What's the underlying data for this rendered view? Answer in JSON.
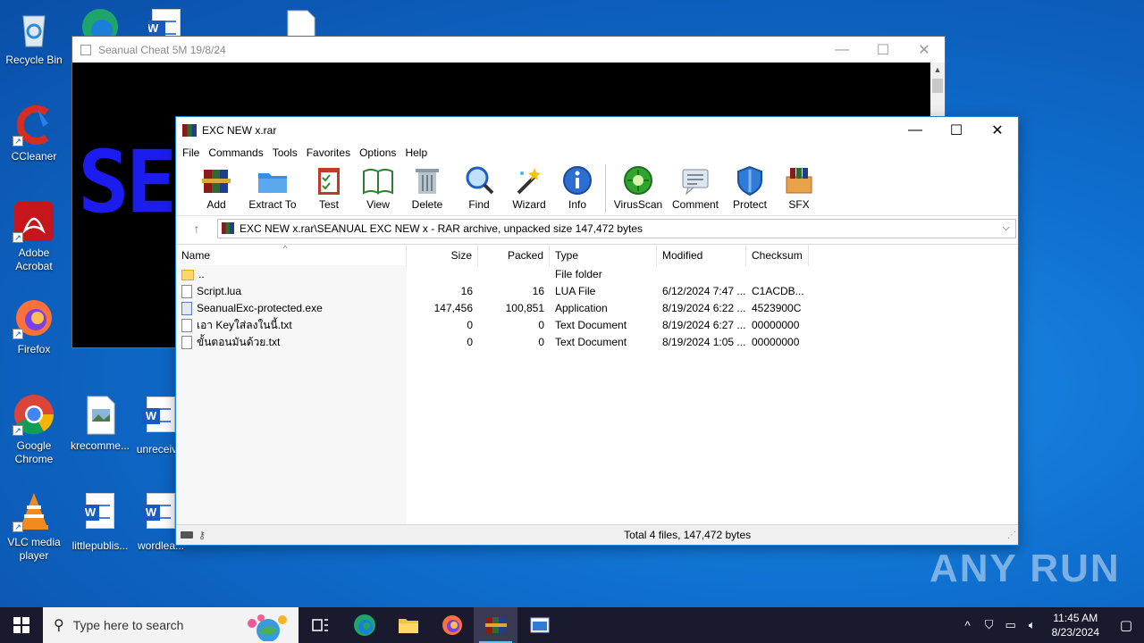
{
  "desktop": {
    "icons": [
      {
        "label": "Recycle Bin"
      },
      {
        "label": "CCleaner"
      },
      {
        "label": "Adobe Acrobat"
      },
      {
        "label": "Firefox"
      },
      {
        "label": "Google Chrome"
      },
      {
        "label": "VLC media player"
      },
      {
        "label": "krecomme..."
      },
      {
        "label": "unreceiv..."
      },
      {
        "label": "littlepublis..."
      },
      {
        "label": "wordlea..."
      }
    ]
  },
  "back_window": {
    "title": "Seanual Cheat 5M 19/8/24",
    "content_text": "SE"
  },
  "winrar": {
    "title": "EXC NEW x.rar",
    "menu": [
      "File",
      "Commands",
      "Tools",
      "Favorites",
      "Options",
      "Help"
    ],
    "toolbar": [
      "Add",
      "Extract To",
      "Test",
      "View",
      "Delete",
      "Find",
      "Wizard",
      "Info",
      "VirusScan",
      "Comment",
      "Protect",
      "SFX"
    ],
    "path": "EXC NEW x.rar\\SEANUAL EXC NEW x - RAR archive, unpacked size 147,472 bytes",
    "columns": {
      "name": "Name",
      "size": "Size",
      "packed": "Packed",
      "type": "Type",
      "modified": "Modified",
      "checksum": "Checksum"
    },
    "rows": [
      {
        "name": "..",
        "size": "",
        "packed": "",
        "type": "File folder",
        "modified": "",
        "checksum": ""
      },
      {
        "name": "Script.lua",
        "size": "16",
        "packed": "16",
        "type": "LUA File",
        "modified": "6/12/2024 7:47 ...",
        "checksum": "C1ACDB..."
      },
      {
        "name": "SeanualExc-protected.exe",
        "size": "147,456",
        "packed": "100,851",
        "type": "Application",
        "modified": "8/19/2024 6:22 ...",
        "checksum": "4523900C"
      },
      {
        "name": "เอา Keyใส่ลงในนี้.txt",
        "size": "0",
        "packed": "0",
        "type": "Text Document",
        "modified": "8/19/2024 6:27 ...",
        "checksum": "00000000"
      },
      {
        "name": "ขั้นตอนมันด้วย.txt",
        "size": "0",
        "packed": "0",
        "type": "Text Document",
        "modified": "8/19/2024 1:05 ...",
        "checksum": "00000000"
      }
    ],
    "status": "Total 4 files, 147,472 bytes"
  },
  "watermark": "ANY RUN",
  "taskbar": {
    "search_placeholder": "Type here to search",
    "time": "11:45 AM",
    "date": "8/23/2024"
  },
  "colors": {
    "desktop": "#0f6fcf",
    "taskbar": "#1a1a2e",
    "accent": "#1883d7"
  }
}
